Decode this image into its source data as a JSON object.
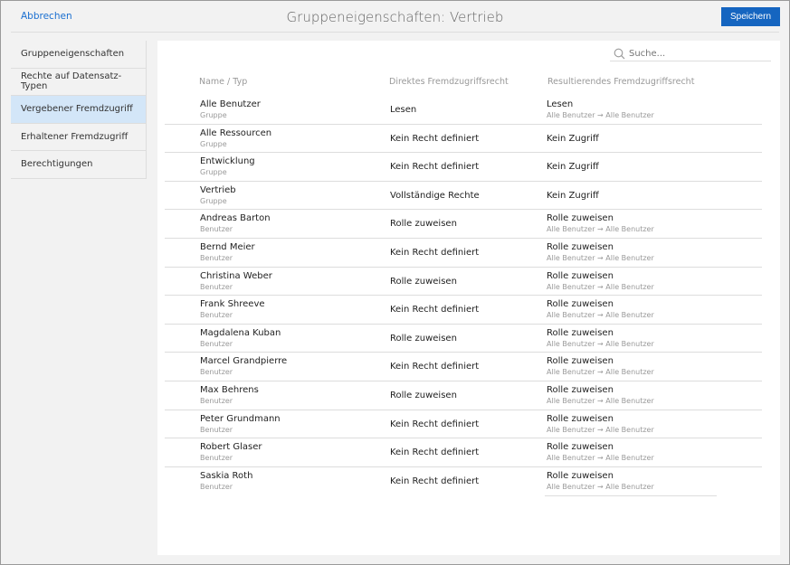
{
  "header": {
    "cancel": "Abbrechen",
    "title": "Gruppeneigenschaften: Vertrieb",
    "save": "Speichern"
  },
  "sidebar": {
    "items": [
      {
        "label": "Gruppeneigenschaften"
      },
      {
        "label": "Rechte auf Datensatz-Typen"
      },
      {
        "label": "Vergebener Fremdzugriff",
        "active": true
      },
      {
        "label": "Erhaltener Fremdzugriff"
      },
      {
        "label": "Berechtigungen"
      }
    ]
  },
  "search": {
    "placeholder": "Suche..."
  },
  "table": {
    "headers": [
      "Name / Typ",
      "Direktes Fremdzugriffsrecht",
      "Resultierendes Fremdzugriffsrecht"
    ],
    "rows": [
      {
        "name": "Alle Benutzer",
        "type": "Gruppe",
        "direct": "Lesen",
        "result": "Lesen",
        "path": "Alle Benutzer → Alle Benutzer"
      },
      {
        "name": "Alle Ressourcen",
        "type": "Gruppe",
        "direct": "Kein Recht definiert",
        "result": "Kein Zugriff",
        "path": ""
      },
      {
        "name": "Entwicklung",
        "type": "Gruppe",
        "direct": "Kein Recht definiert",
        "result": "Kein Zugriff",
        "path": ""
      },
      {
        "name": "Vertrieb",
        "type": "Gruppe",
        "direct": "Vollständige Rechte",
        "result": "Kein Zugriff",
        "path": ""
      },
      {
        "name": "Andreas Barton",
        "type": "Benutzer",
        "direct": "Rolle zuweisen",
        "result": "Rolle zuweisen",
        "path": "Alle Benutzer → Alle Benutzer"
      },
      {
        "name": "Bernd Meier",
        "type": "Benutzer",
        "direct": "Kein Recht definiert",
        "result": "Rolle zuweisen",
        "path": "Alle Benutzer → Alle Benutzer"
      },
      {
        "name": "Christina Weber",
        "type": "Benutzer",
        "direct": "Rolle zuweisen",
        "result": "Rolle zuweisen",
        "path": "Alle Benutzer → Alle Benutzer"
      },
      {
        "name": "Frank Shreeve",
        "type": "Benutzer",
        "direct": "Kein Recht definiert",
        "result": "Rolle zuweisen",
        "path": "Alle Benutzer → Alle Benutzer"
      },
      {
        "name": "Magdalena Kuban",
        "type": "Benutzer",
        "direct": "Rolle zuweisen",
        "result": "Rolle zuweisen",
        "path": "Alle Benutzer → Alle Benutzer"
      },
      {
        "name": "Marcel Grandpierre",
        "type": "Benutzer",
        "direct": "Kein Recht definiert",
        "result": "Rolle zuweisen",
        "path": "Alle Benutzer → Alle Benutzer"
      },
      {
        "name": "Max Behrens",
        "type": "Benutzer",
        "direct": "Rolle zuweisen",
        "result": "Rolle zuweisen",
        "path": "Alle Benutzer → Alle Benutzer"
      },
      {
        "name": "Peter Grundmann",
        "type": "Benutzer",
        "direct": "Kein Recht definiert",
        "result": "Rolle zuweisen",
        "path": "Alle Benutzer → Alle Benutzer"
      },
      {
        "name": "Robert Glaser",
        "type": "Benutzer",
        "direct": "Kein Recht definiert",
        "result": "Rolle zuweisen",
        "path": "Alle Benutzer → Alle Benutzer"
      },
      {
        "name": "Saskia Roth",
        "type": "Benutzer",
        "direct": "Kein Recht definiert",
        "result": "Rolle zuweisen",
        "path": "Alle Benutzer → Alle Benutzer"
      }
    ]
  }
}
